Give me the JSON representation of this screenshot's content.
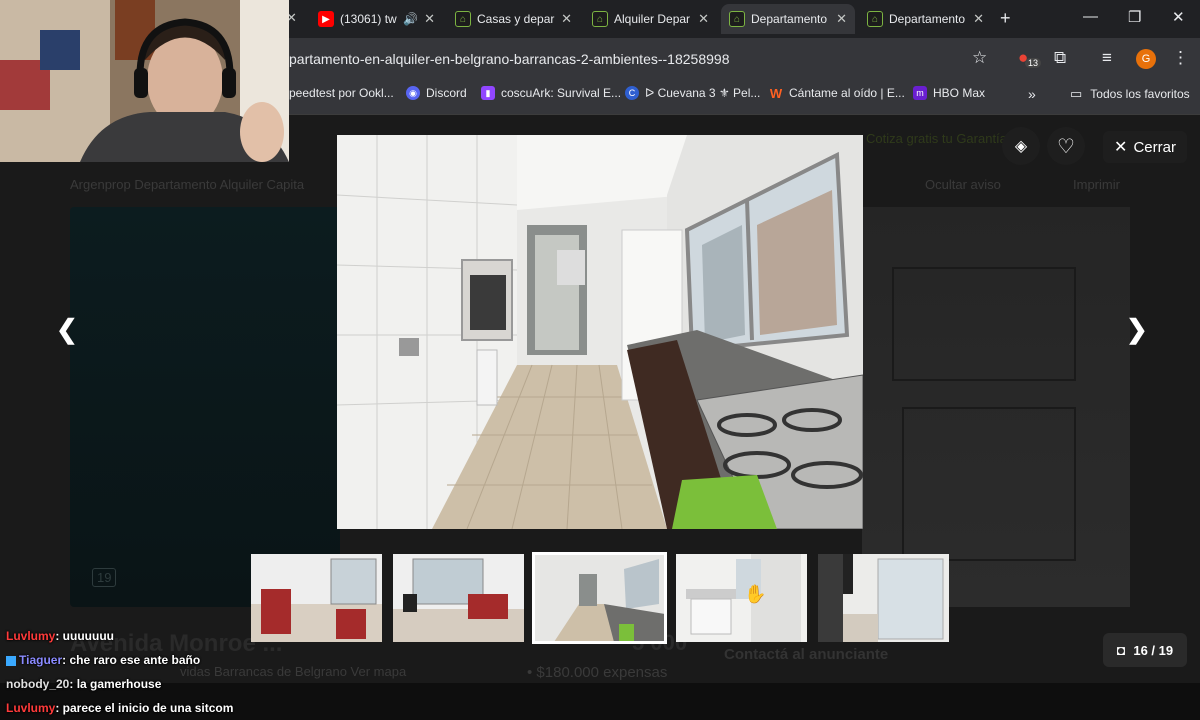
{
  "browser": {
    "tabs": [
      {
        "title": "(13061) tw",
        "favicon": "youtube-icon",
        "audio": true
      },
      {
        "title": "Casas y depar",
        "favicon": "argenprop-icon"
      },
      {
        "title": "Alquiler Depar",
        "favicon": "argenprop-icon"
      },
      {
        "title": "Departamento",
        "favicon": "argenprop-icon",
        "active": true
      },
      {
        "title": "Departamento",
        "favicon": "argenprop-icon"
      }
    ],
    "url": "partamento-en-alquiler-en-belgrano-barrancas-2-ambientes--18258998",
    "extension_badge": "13",
    "profile_initial": "G",
    "bookmarks": [
      {
        "label": "peedtest por Ookl...",
        "icon": "speedtest-icon"
      },
      {
        "label": "Discord",
        "icon": "discord-icon"
      },
      {
        "label": "coscuArk: Survival E...",
        "icon": "twitch-icon"
      },
      {
        "label": "ᐅ Cuevana 3 ⚜ Pel...",
        "icon": "cuevana-icon"
      },
      {
        "label": "Cántame al oído | E...",
        "icon": "wattpad-icon"
      },
      {
        "label": "HBO Max",
        "icon": "hbomax-icon"
      }
    ],
    "all_bookmarks_label": "Todos los favoritos"
  },
  "page_background": {
    "breadcrumb": "Argenprop  Departamento  Alquiler  Capita",
    "ocultar": "Ocultar aviso",
    "imprimir": "Imprimir",
    "cotiza": "Cotiza gratis tu Garantía",
    "photo_count_badge": "19",
    "address": "Avenida Monroe ...",
    "subaddress": "vidas Barrancas de Belgrano  Ver mapa",
    "price": "5 000",
    "expensas": "• $180.000 expensas",
    "contact": "Contactá al anunciante"
  },
  "gallery": {
    "close_label": "Cerrar",
    "counter": "16 / 19",
    "thumbnails": [
      {
        "desc": "living-room-red-bench"
      },
      {
        "desc": "living-room-window"
      },
      {
        "desc": "kitchen",
        "active": true
      },
      {
        "desc": "bathroom"
      },
      {
        "desc": "balcony-door"
      }
    ]
  },
  "chat": [
    {
      "user": "Luvlumy",
      "msg": ": uuuuuuu",
      "color": "#ff3b3b"
    },
    {
      "user": "Tiaguer",
      "msg": ": che raro ese ante baño",
      "color": "#8a8aff",
      "badge": true
    },
    {
      "user": "nobody_20",
      "msg": ": la gamerhouse",
      "color": "#e0e0e0"
    },
    {
      "user": "Luvlumy",
      "msg": ": parece el inicio de una sitcom",
      "color": "#ff3b3b"
    }
  ]
}
